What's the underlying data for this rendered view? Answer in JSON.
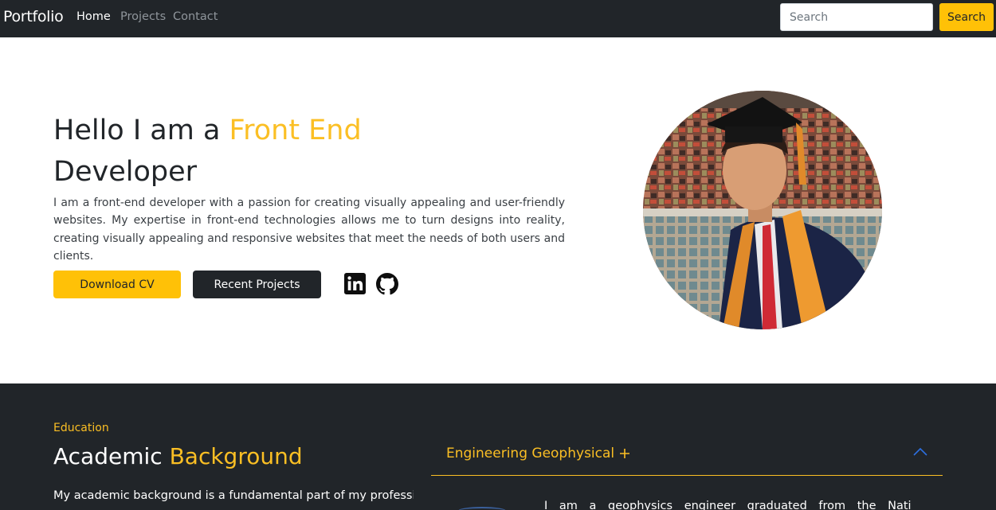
{
  "navbar": {
    "brand": "Portfolio",
    "links": [
      "Home",
      "Projects",
      "Contact"
    ],
    "active_link": "Home",
    "search_placeholder": "Search",
    "search_button": "Search"
  },
  "hero": {
    "title_prefix": "Hello I am a ",
    "title_accent": "Front End",
    "title_suffix": "Developer",
    "description": "I am a front-end developer with a passion for creating visually appealing and user-friendly websites. My expertise in front-end technologies allows me to turn designs into reality, creating visually appealing and responsive websites that meet the needs of both users and clients.",
    "download_button": "Download CV",
    "projects_button": "Recent Projects",
    "social_icons": [
      "linkedin-icon",
      "github-icon"
    ]
  },
  "education": {
    "label": "Education",
    "title_plain": "Academic ",
    "title_accent": "Background",
    "description": "My academic background is a fundamental part of my professional",
    "accordion": {
      "title": "Engineering Geophysical",
      "expanded": true,
      "body": "I am a geophysics engineer graduated from the National"
    }
  },
  "colors": {
    "accent": "#ffc107",
    "accent_text": "#fbbf24",
    "dark": "#212529"
  }
}
